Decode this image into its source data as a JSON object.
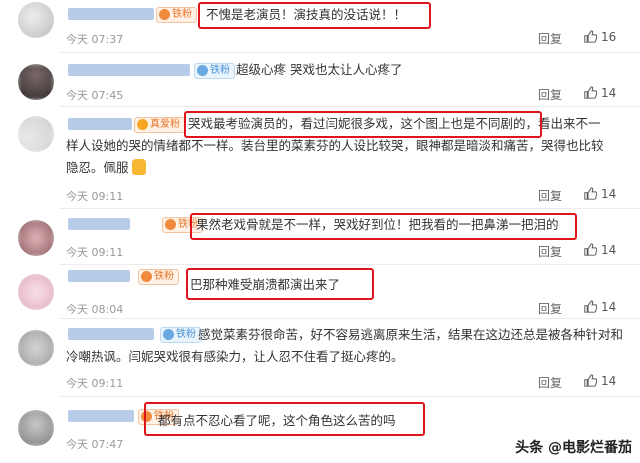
{
  "reply_label": "回复",
  "watermark": "头条 @电影烂番茄",
  "comments": [
    {
      "badge": "铁粉",
      "text_lines": [
        "不愧是老演员！演技真的没话说！！"
      ],
      "time": "今天 07:37",
      "likes": "16"
    },
    {
      "badge": "铁粉",
      "text_lines": [
        "超级心疼 哭戏也太让人心疼了"
      ],
      "time": "今天 07:45",
      "likes": "14"
    },
    {
      "badge": "真爱粉",
      "text_lines": [
        "哭戏最考验演员的，看过闫妮很多戏，这个图上也是不同剧的，看出来不一",
        "样人设她的哭的情绪都不一样。装台里的菜素芬的人设比较哭，眼神都是暗淡和痛苦，哭得也比较",
        "隐忍。佩服"
      ],
      "time": "今天 09:11",
      "likes": "14"
    },
    {
      "badge": "铁粉",
      "text_lines": [
        "果然老戏骨就是不一样，哭戏好到位！把我看的一把鼻涕一把泪的"
      ],
      "time": "今天 09:11",
      "likes": "14"
    },
    {
      "badge": "铁粉",
      "text_lines": [
        "巴那种难受崩溃都演出来了"
      ],
      "time": "今天 08:04",
      "likes": "14"
    },
    {
      "badge": "铁粉",
      "text_lines": [
        "感觉菜素芬很命苦，好不容易逃离原来生活，结果在这边还总是被各种针对和",
        "冷嘲热讽。闫妮哭戏很有感染力，让人忍不住看了挺心疼的。"
      ],
      "time": "今天 09:11",
      "likes": "14"
    },
    {
      "badge": "铁粉",
      "text_lines": [
        "都有点不忍心看了呢，这个角色这么苦的吗"
      ],
      "time": "今天 07:47",
      "likes": ""
    }
  ]
}
